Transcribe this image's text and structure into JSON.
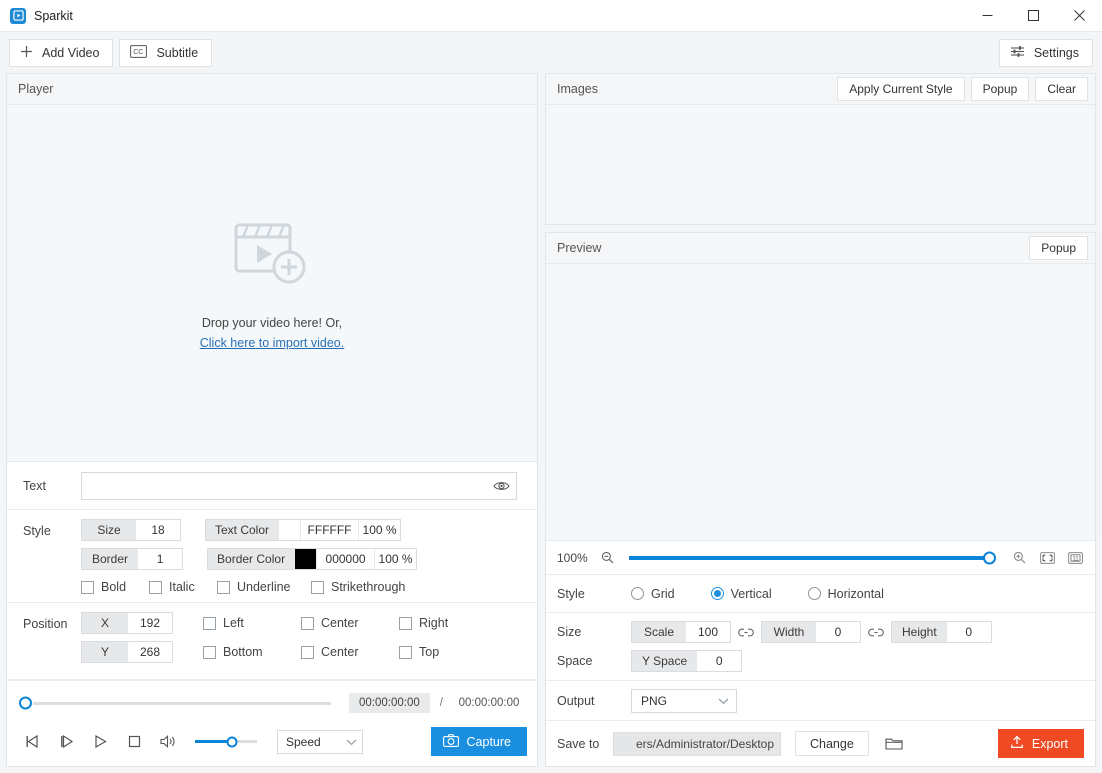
{
  "window": {
    "title": "Sparkit",
    "app_icon": "sparkit-logo-icon",
    "minimize": "minimize-icon",
    "maximize": "maximize-icon",
    "close": "close-icon"
  },
  "toolbar": {
    "add_video_label": "Add Video",
    "subtitle_label": "Subtitle",
    "settings_label": "Settings"
  },
  "player": {
    "pane_title": "Player",
    "drop_text": "Drop your video here! Or,",
    "drop_link": "Click here to import video."
  },
  "text_section": {
    "label": "Text",
    "value": "",
    "placeholder": "",
    "eye_icon": "eye-icon"
  },
  "style_section": {
    "label": "Style",
    "size_label": "Size",
    "size_value": "18",
    "border_label": "Border",
    "border_value": "1",
    "text_color_label": "Text Color",
    "text_color_hex": "FFFFFF",
    "text_color_swatch": "#ffffff",
    "text_color_opacity": "100 %",
    "border_color_label": "Border Color",
    "border_color_hex": "000000",
    "border_color_swatch": "#000000",
    "border_color_opacity": "100 %",
    "checks": [
      {
        "label": "Bold",
        "checked": false
      },
      {
        "label": "Italic",
        "checked": false
      },
      {
        "label": "Underline",
        "checked": false
      },
      {
        "label": "Strikethrough",
        "checked": false
      }
    ]
  },
  "position_section": {
    "label": "Position",
    "x_label": "X",
    "x_value": "192",
    "y_label": "Y",
    "y_value": "268",
    "row1": [
      {
        "label": "Left",
        "checked": false
      },
      {
        "label": "Center",
        "checked": false
      },
      {
        "label": "Right",
        "checked": false
      }
    ],
    "row2": [
      {
        "label": "Bottom",
        "checked": false
      },
      {
        "label": "Center",
        "checked": false
      },
      {
        "label": "Top",
        "checked": false
      }
    ]
  },
  "transport": {
    "seek_position_pct": 0,
    "current_time": "00:00:00:00",
    "time_separator": "/",
    "total_time": "00:00:00:00",
    "prev_frame_icon": "previous-frame-icon",
    "next_frame_icon": "next-frame-icon",
    "play_icon": "play-icon",
    "stop_icon": "stop-icon",
    "volume_icon": "volume-icon",
    "volume_pct": 60,
    "speed_label": "Speed",
    "capture_label": "Capture",
    "capture_icon": "camera-icon",
    "capture_color": "#1a8fe0"
  },
  "images_section": {
    "pane_title": "Images",
    "apply_current_style": "Apply Current Style",
    "popup": "Popup",
    "clear": "Clear"
  },
  "preview_section": {
    "pane_title": "Preview",
    "popup": "Popup"
  },
  "zoom_bar": {
    "percent": "100%",
    "zoom_out_icon": "zoom-out-icon",
    "zoom_in_icon": "zoom-in-icon",
    "fit_screen_icon": "fit-to-screen-icon",
    "actual_size_icon": "actual-size-icon",
    "slider_pct": 100
  },
  "style_layout": {
    "label": "Style",
    "options": [
      {
        "label": "Grid",
        "selected": false
      },
      {
        "label": "Vertical",
        "selected": true
      },
      {
        "label": "Horizontal",
        "selected": false
      }
    ]
  },
  "size_section": {
    "size_label": "Size",
    "scale_label": "Scale",
    "scale_value": "100",
    "width_label": "Width",
    "width_value": "0",
    "height_label": "Height",
    "height_value": "0",
    "link_icon": "link-icon",
    "space_label": "Space",
    "y_space_label": "Y Space",
    "y_space_value": "0"
  },
  "output_section": {
    "label": "Output",
    "format": "PNG",
    "save_to_label": "Save to",
    "save_path": "ers/Administrator/Desktop",
    "change_label": "Change",
    "folder_icon": "folder-icon",
    "export_label": "Export",
    "export_icon": "upload-icon",
    "export_color": "#ef4a23"
  }
}
